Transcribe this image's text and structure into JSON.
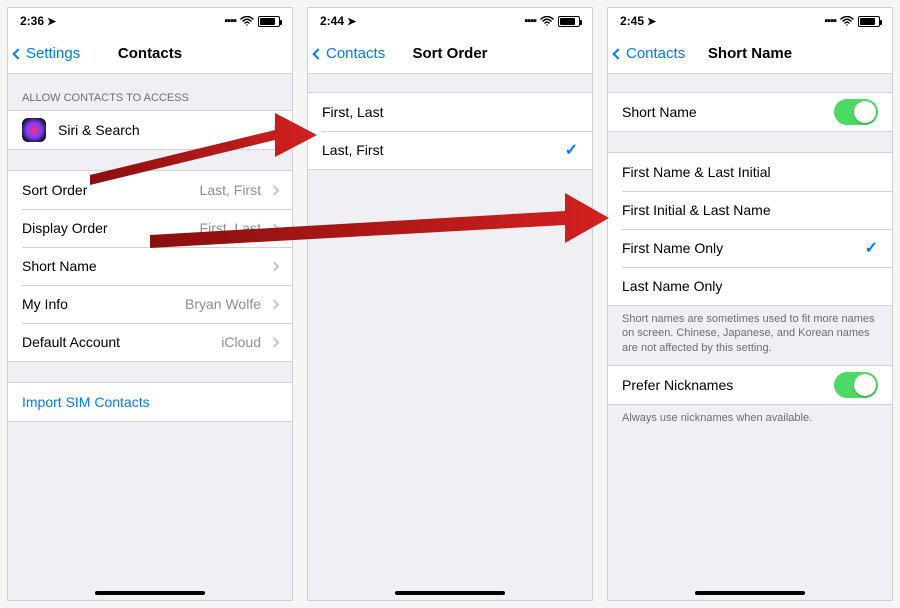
{
  "colors": {
    "ios_blue": "#007aff",
    "ios_green": "#4cd964",
    "ios_gray_value": "#8e8e93"
  },
  "screen1": {
    "status": {
      "time": "2:36"
    },
    "back_label": "Settings",
    "title": "Contacts",
    "header_access": "ALLOW CONTACTS TO ACCESS",
    "siri_label": "Siri & Search",
    "rows": {
      "sort_order": {
        "label": "Sort Order",
        "value": "Last, First"
      },
      "display_order": {
        "label": "Display Order",
        "value": "First, Last"
      },
      "short_name": {
        "label": "Short Name",
        "value": ""
      },
      "my_info": {
        "label": "My Info",
        "value": "Bryan Wolfe"
      },
      "default_account": {
        "label": "Default Account",
        "value": "iCloud"
      }
    },
    "import_sim": "Import SIM Contacts"
  },
  "screen2": {
    "status": {
      "time": "2:44"
    },
    "back_label": "Contacts",
    "title": "Sort Order",
    "options": [
      {
        "label": "First, Last",
        "selected": false
      },
      {
        "label": "Last, First",
        "selected": true
      }
    ]
  },
  "screen3": {
    "status": {
      "time": "2:45"
    },
    "back_label": "Contacts",
    "title": "Short Name",
    "short_name_toggle": {
      "label": "Short Name",
      "on": true
    },
    "options": [
      {
        "label": "First Name & Last Initial",
        "selected": false
      },
      {
        "label": "First Initial & Last Name",
        "selected": false
      },
      {
        "label": "First Name Only",
        "selected": true
      },
      {
        "label": "Last Name Only",
        "selected": false
      }
    ],
    "footer1": "Short names are sometimes used to fit more names on screen. Chinese, Japanese, and Korean names are not affected by this setting.",
    "prefer_nicknames": {
      "label": "Prefer Nicknames",
      "on": true
    },
    "footer2": "Always use nicknames when available."
  }
}
